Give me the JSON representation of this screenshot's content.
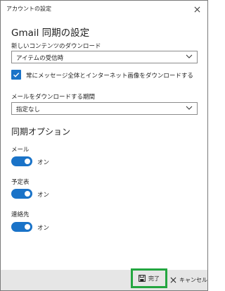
{
  "window": {
    "title": "アカウントの設定"
  },
  "heading": "Gmail 同期の設定",
  "download_content": {
    "label": "新しいコンテンツのダウンロード",
    "value": "アイテムの受信時"
  },
  "full_message_checkbox": {
    "checked": true,
    "label": "常にメッセージ全体とインターネット画像をダウンロードする"
  },
  "download_period": {
    "label": "メールをダウンロードする期間",
    "value": "指定なし"
  },
  "sync_options": {
    "title": "同期オプション",
    "items": [
      {
        "label": "メール",
        "state": "オン",
        "on": true
      },
      {
        "label": "予定表",
        "state": "オン",
        "on": true
      },
      {
        "label": "連絡先",
        "state": "オン",
        "on": true
      }
    ]
  },
  "footer": {
    "done_label": "完了",
    "cancel_label": "キャンセル"
  },
  "colors": {
    "accent": "#1a73c8",
    "done_highlight": "#23a640",
    "footer_bg": "#e6e6e6"
  },
  "icons": {
    "close": "close-icon",
    "chevron": "chevron-down-icon",
    "save": "save-icon",
    "cancel": "cancel-icon",
    "check": "check-icon"
  }
}
